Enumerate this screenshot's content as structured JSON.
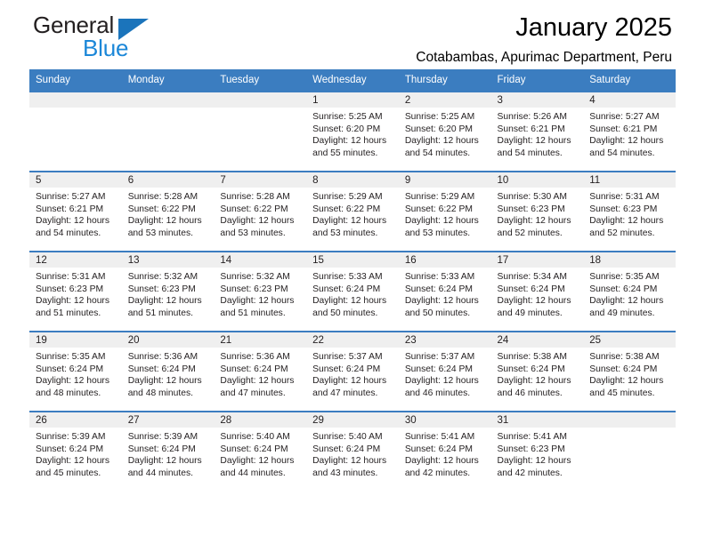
{
  "brand": {
    "name_part1": "General",
    "name_part2": "Blue",
    "triangle_color": "#1b74bb",
    "blue_text_color": "#1b87d8"
  },
  "header": {
    "month_title": "January 2025",
    "location": "Cotabambas, Apurimac Department, Peru"
  },
  "theme": {
    "header_blue": "#3b7dc0",
    "daynum_band": "#efefef",
    "text": "#231f20"
  },
  "calendar": {
    "weekday_headers": [
      "Sunday",
      "Monday",
      "Tuesday",
      "Wednesday",
      "Thursday",
      "Friday",
      "Saturday"
    ],
    "weeks": [
      [
        {
          "day": "",
          "sunrise": "",
          "sunset": "",
          "daylight_line1": "",
          "daylight_line2": ""
        },
        {
          "day": "",
          "sunrise": "",
          "sunset": "",
          "daylight_line1": "",
          "daylight_line2": ""
        },
        {
          "day": "",
          "sunrise": "",
          "sunset": "",
          "daylight_line1": "",
          "daylight_line2": ""
        },
        {
          "day": "1",
          "sunrise": "Sunrise: 5:25 AM",
          "sunset": "Sunset: 6:20 PM",
          "daylight_line1": "Daylight: 12 hours",
          "daylight_line2": "and 55 minutes."
        },
        {
          "day": "2",
          "sunrise": "Sunrise: 5:25 AM",
          "sunset": "Sunset: 6:20 PM",
          "daylight_line1": "Daylight: 12 hours",
          "daylight_line2": "and 54 minutes."
        },
        {
          "day": "3",
          "sunrise": "Sunrise: 5:26 AM",
          "sunset": "Sunset: 6:21 PM",
          "daylight_line1": "Daylight: 12 hours",
          "daylight_line2": "and 54 minutes."
        },
        {
          "day": "4",
          "sunrise": "Sunrise: 5:27 AM",
          "sunset": "Sunset: 6:21 PM",
          "daylight_line1": "Daylight: 12 hours",
          "daylight_line2": "and 54 minutes."
        }
      ],
      [
        {
          "day": "5",
          "sunrise": "Sunrise: 5:27 AM",
          "sunset": "Sunset: 6:21 PM",
          "daylight_line1": "Daylight: 12 hours",
          "daylight_line2": "and 54 minutes."
        },
        {
          "day": "6",
          "sunrise": "Sunrise: 5:28 AM",
          "sunset": "Sunset: 6:22 PM",
          "daylight_line1": "Daylight: 12 hours",
          "daylight_line2": "and 53 minutes."
        },
        {
          "day": "7",
          "sunrise": "Sunrise: 5:28 AM",
          "sunset": "Sunset: 6:22 PM",
          "daylight_line1": "Daylight: 12 hours",
          "daylight_line2": "and 53 minutes."
        },
        {
          "day": "8",
          "sunrise": "Sunrise: 5:29 AM",
          "sunset": "Sunset: 6:22 PM",
          "daylight_line1": "Daylight: 12 hours",
          "daylight_line2": "and 53 minutes."
        },
        {
          "day": "9",
          "sunrise": "Sunrise: 5:29 AM",
          "sunset": "Sunset: 6:22 PM",
          "daylight_line1": "Daylight: 12 hours",
          "daylight_line2": "and 53 minutes."
        },
        {
          "day": "10",
          "sunrise": "Sunrise: 5:30 AM",
          "sunset": "Sunset: 6:23 PM",
          "daylight_line1": "Daylight: 12 hours",
          "daylight_line2": "and 52 minutes."
        },
        {
          "day": "11",
          "sunrise": "Sunrise: 5:31 AM",
          "sunset": "Sunset: 6:23 PM",
          "daylight_line1": "Daylight: 12 hours",
          "daylight_line2": "and 52 minutes."
        }
      ],
      [
        {
          "day": "12",
          "sunrise": "Sunrise: 5:31 AM",
          "sunset": "Sunset: 6:23 PM",
          "daylight_line1": "Daylight: 12 hours",
          "daylight_line2": "and 51 minutes."
        },
        {
          "day": "13",
          "sunrise": "Sunrise: 5:32 AM",
          "sunset": "Sunset: 6:23 PM",
          "daylight_line1": "Daylight: 12 hours",
          "daylight_line2": "and 51 minutes."
        },
        {
          "day": "14",
          "sunrise": "Sunrise: 5:32 AM",
          "sunset": "Sunset: 6:23 PM",
          "daylight_line1": "Daylight: 12 hours",
          "daylight_line2": "and 51 minutes."
        },
        {
          "day": "15",
          "sunrise": "Sunrise: 5:33 AM",
          "sunset": "Sunset: 6:24 PM",
          "daylight_line1": "Daylight: 12 hours",
          "daylight_line2": "and 50 minutes."
        },
        {
          "day": "16",
          "sunrise": "Sunrise: 5:33 AM",
          "sunset": "Sunset: 6:24 PM",
          "daylight_line1": "Daylight: 12 hours",
          "daylight_line2": "and 50 minutes."
        },
        {
          "day": "17",
          "sunrise": "Sunrise: 5:34 AM",
          "sunset": "Sunset: 6:24 PM",
          "daylight_line1": "Daylight: 12 hours",
          "daylight_line2": "and 49 minutes."
        },
        {
          "day": "18",
          "sunrise": "Sunrise: 5:35 AM",
          "sunset": "Sunset: 6:24 PM",
          "daylight_line1": "Daylight: 12 hours",
          "daylight_line2": "and 49 minutes."
        }
      ],
      [
        {
          "day": "19",
          "sunrise": "Sunrise: 5:35 AM",
          "sunset": "Sunset: 6:24 PM",
          "daylight_line1": "Daylight: 12 hours",
          "daylight_line2": "and 48 minutes."
        },
        {
          "day": "20",
          "sunrise": "Sunrise: 5:36 AM",
          "sunset": "Sunset: 6:24 PM",
          "daylight_line1": "Daylight: 12 hours",
          "daylight_line2": "and 48 minutes."
        },
        {
          "day": "21",
          "sunrise": "Sunrise: 5:36 AM",
          "sunset": "Sunset: 6:24 PM",
          "daylight_line1": "Daylight: 12 hours",
          "daylight_line2": "and 47 minutes."
        },
        {
          "day": "22",
          "sunrise": "Sunrise: 5:37 AM",
          "sunset": "Sunset: 6:24 PM",
          "daylight_line1": "Daylight: 12 hours",
          "daylight_line2": "and 47 minutes."
        },
        {
          "day": "23",
          "sunrise": "Sunrise: 5:37 AM",
          "sunset": "Sunset: 6:24 PM",
          "daylight_line1": "Daylight: 12 hours",
          "daylight_line2": "and 46 minutes."
        },
        {
          "day": "24",
          "sunrise": "Sunrise: 5:38 AM",
          "sunset": "Sunset: 6:24 PM",
          "daylight_line1": "Daylight: 12 hours",
          "daylight_line2": "and 46 minutes."
        },
        {
          "day": "25",
          "sunrise": "Sunrise: 5:38 AM",
          "sunset": "Sunset: 6:24 PM",
          "daylight_line1": "Daylight: 12 hours",
          "daylight_line2": "and 45 minutes."
        }
      ],
      [
        {
          "day": "26",
          "sunrise": "Sunrise: 5:39 AM",
          "sunset": "Sunset: 6:24 PM",
          "daylight_line1": "Daylight: 12 hours",
          "daylight_line2": "and 45 minutes."
        },
        {
          "day": "27",
          "sunrise": "Sunrise: 5:39 AM",
          "sunset": "Sunset: 6:24 PM",
          "daylight_line1": "Daylight: 12 hours",
          "daylight_line2": "and 44 minutes."
        },
        {
          "day": "28",
          "sunrise": "Sunrise: 5:40 AM",
          "sunset": "Sunset: 6:24 PM",
          "daylight_line1": "Daylight: 12 hours",
          "daylight_line2": "and 44 minutes."
        },
        {
          "day": "29",
          "sunrise": "Sunrise: 5:40 AM",
          "sunset": "Sunset: 6:24 PM",
          "daylight_line1": "Daylight: 12 hours",
          "daylight_line2": "and 43 minutes."
        },
        {
          "day": "30",
          "sunrise": "Sunrise: 5:41 AM",
          "sunset": "Sunset: 6:24 PM",
          "daylight_line1": "Daylight: 12 hours",
          "daylight_line2": "and 42 minutes."
        },
        {
          "day": "31",
          "sunrise": "Sunrise: 5:41 AM",
          "sunset": "Sunset: 6:23 PM",
          "daylight_line1": "Daylight: 12 hours",
          "daylight_line2": "and 42 minutes."
        },
        {
          "day": "",
          "sunrise": "",
          "sunset": "",
          "daylight_line1": "",
          "daylight_line2": ""
        }
      ]
    ]
  }
}
